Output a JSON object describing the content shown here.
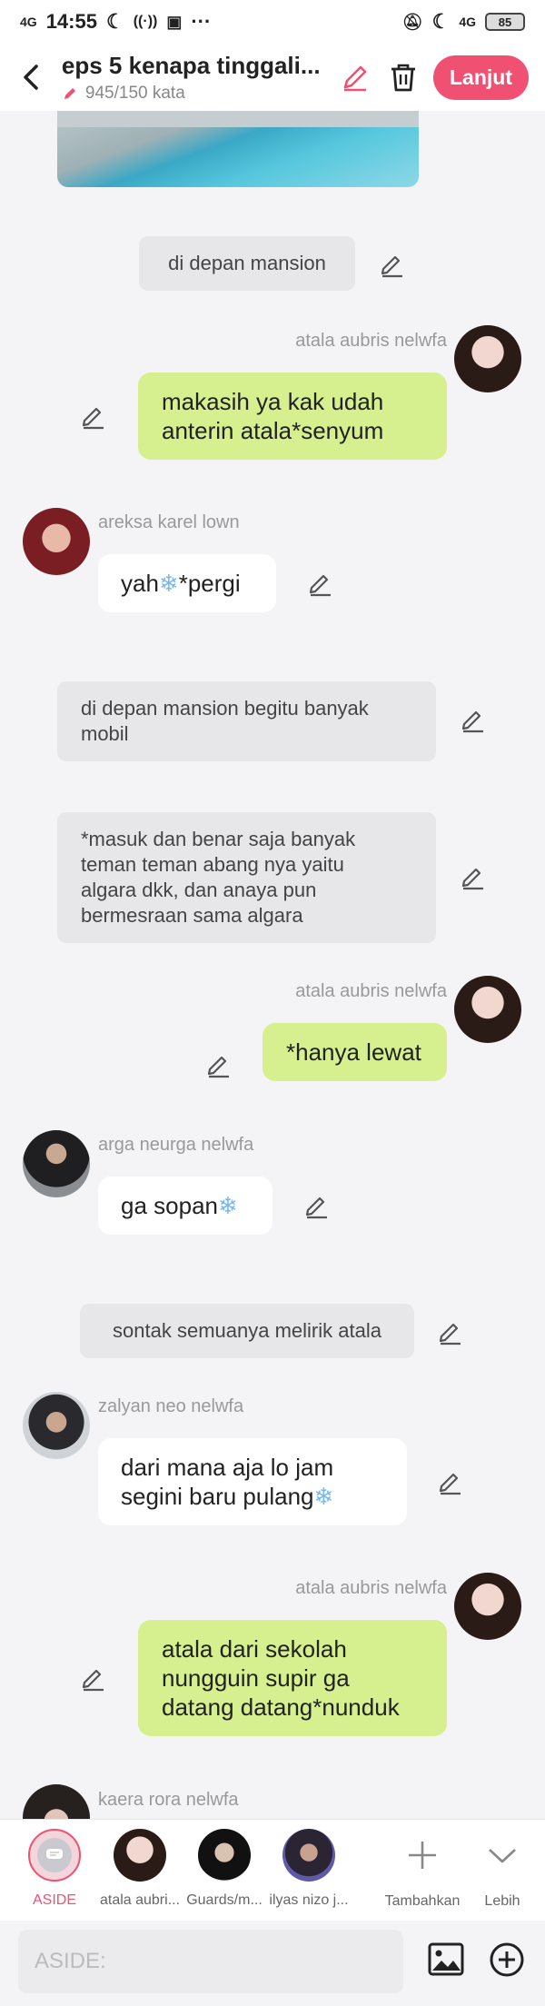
{
  "status_bar": {
    "network": "4G",
    "time": "14:55",
    "extra": "···",
    "network_right": "4G",
    "battery": "85"
  },
  "header": {
    "title": "eps 5 kenapa tinggali...",
    "word_count": "945/150 kata",
    "next_label": "Lanjut"
  },
  "messages": {
    "m1": "di depan mansion",
    "m2_name": "atala aubris nelwfa",
    "m2_line1": "makasih ya kak udah",
    "m2_line2": "anterin atala*senyum",
    "m3_name": "areksa karel lown",
    "m3_a": "yah",
    "m3_b": "*pergi",
    "m4_line1": "di depan mansion begitu banyak",
    "m4_line2": "mobil",
    "m5_line1": "*masuk dan benar saja banyak",
    "m5_line2": "teman teman abang nya yaitu",
    "m5_line3": "algara dkk, dan anaya pun",
    "m5_line4": "bermesraan sama algara",
    "m6_name": "atala aubris nelwfa",
    "m6": "*hanya lewat",
    "m7_name": "arga neurga nelwfa",
    "m7": "ga sopan",
    "m8": "sontak semuanya melirik atala",
    "m9_name": "zalyan neo nelwfa",
    "m9_line1": "dari mana aja lo jam",
    "m9_line2": "segini baru pulang",
    "m10_name": "atala aubris nelwfa",
    "m10_line1": "atala dari sekolah",
    "m10_line2": "nungguin supir ga",
    "m10_line3": "datang datang*nunduk",
    "m11_name": "kaera rora nelwfa"
  },
  "bottom_bar": {
    "aside_label": "ASIDE",
    "char1": "atala aubri...",
    "char2": "Guards/m...",
    "char3": "ilyas nizo j...",
    "add_label": "Tambahkan",
    "more_label": "Lebih"
  },
  "input": {
    "placeholder": "ASIDE:"
  },
  "colors": {
    "accent": "#f05071",
    "green_bubble": "#d6f08f",
    "narration_bg": "#e7e7ea"
  }
}
